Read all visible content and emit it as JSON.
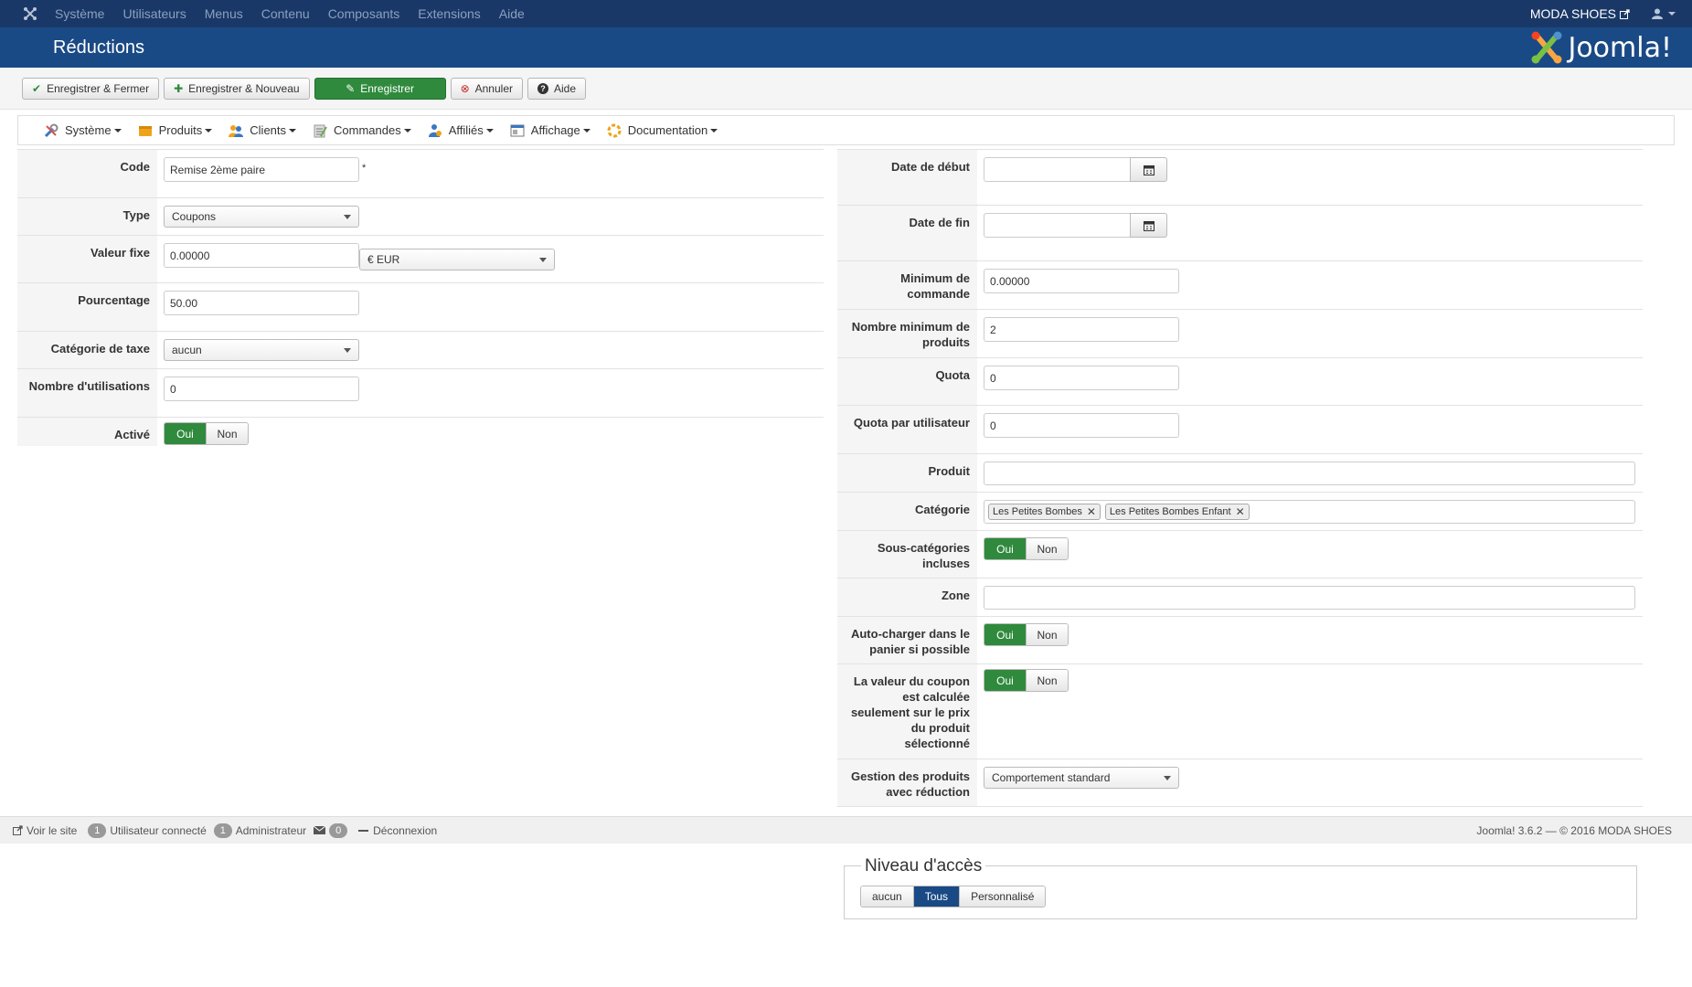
{
  "topbar": {
    "nav": [
      "Système",
      "Utilisateurs",
      "Menus",
      "Contenu",
      "Composants",
      "Extensions",
      "Aide"
    ],
    "site_name": "MODA SHOES"
  },
  "titlebar": {
    "title": "Réductions",
    "brand": "Joomla!"
  },
  "toolbar": {
    "save_close": "Enregistrer & Fermer",
    "save_new": "Enregistrer & Nouveau",
    "save": "Enregistrer",
    "cancel": "Annuler",
    "help": "Aide"
  },
  "component_menu": [
    "Système",
    "Produits",
    "Clients",
    "Commandes",
    "Affiliés",
    "Affichage",
    "Documentation"
  ],
  "left_form": {
    "code": {
      "label": "Code",
      "value": "Remise 2ème paire",
      "required_mark": "*"
    },
    "type": {
      "label": "Type",
      "value": "Coupons"
    },
    "valeur_fixe": {
      "label": "Valeur fixe",
      "value": "0.00000",
      "currency": "€ EUR"
    },
    "pourcentage": {
      "label": "Pourcentage",
      "value": "50.00"
    },
    "categorie_taxe": {
      "label": "Catégorie de taxe",
      "value": "aucun"
    },
    "nombre_utilisations": {
      "label": "Nombre d'utilisations",
      "value": "0"
    },
    "active": {
      "label": "Activé",
      "yes": "Oui",
      "no": "Non"
    }
  },
  "right_form": {
    "date_debut": {
      "label": "Date de début",
      "value": ""
    },
    "date_fin": {
      "label": "Date de fin",
      "value": ""
    },
    "minimum_commande": {
      "label": "Minimum de commande",
      "value": "0.00000"
    },
    "nombre_min_produits": {
      "label": "Nombre minimum de produits",
      "value": "2"
    },
    "quota": {
      "label": "Quota",
      "value": "0"
    },
    "quota_utilisateur": {
      "label": "Quota par utilisateur",
      "value": "0"
    },
    "produit": {
      "label": "Produit",
      "value": ""
    },
    "categorie": {
      "label": "Catégorie",
      "tags": [
        "Les Petites Bombes",
        "Les Petites Bombes Enfant"
      ]
    },
    "sous_categories": {
      "label": "Sous-catégories incluses",
      "yes": "Oui",
      "no": "Non"
    },
    "zone": {
      "label": "Zone",
      "value": ""
    },
    "auto_charger": {
      "label": "Auto-charger dans le panier si possible",
      "yes": "Oui",
      "no": "Non"
    },
    "valeur_coupon": {
      "label": "La valeur du coupon est calculée seulement sur le prix du produit sélectionné",
      "yes": "Oui",
      "no": "Non"
    },
    "gestion_produits": {
      "label": "Gestion des produits avec réduction",
      "value": "Comportement standard"
    }
  },
  "statusbar": {
    "view_site": "Voir le site",
    "users_count": "1",
    "users_label": "Utilisateur connecté",
    "admin_count": "1",
    "admin_label": "Administrateur",
    "messages_count": "0",
    "logout": "Déconnexion",
    "version": "Joomla! 3.6.2 — © 2016 MODA SHOES"
  },
  "access": {
    "legend": "Niveau d'accès",
    "options": [
      "aucun",
      "Tous",
      "Personnalisé"
    ],
    "selected": "Tous"
  },
  "colors": {
    "topbar": "#1a3867",
    "titlebar": "#1a4a85",
    "green": "#2f8a3d"
  }
}
